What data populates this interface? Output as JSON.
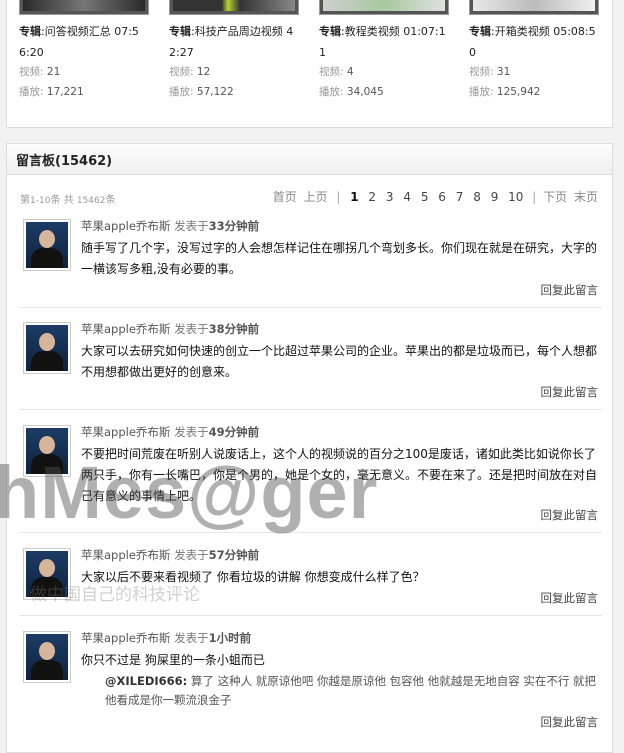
{
  "albums": [
    {
      "prefix": "专辑",
      "title": ":问答视频汇总 07:56:20",
      "videos_label": "视频",
      "videos": "21",
      "plays_label": "播放",
      "plays": "17,221"
    },
    {
      "prefix": "专辑",
      "title": ":科技产品周边视频 42:27",
      "videos_label": "视频",
      "videos": "12",
      "plays_label": "播放",
      "plays": "57,122"
    },
    {
      "prefix": "专辑",
      "title": ":教程类视频 01:07:11",
      "videos_label": "视频",
      "videos": "4",
      "plays_label": "播放",
      "plays": "34,045"
    },
    {
      "prefix": "专辑",
      "title": ":开箱类视频 05:08:50",
      "videos_label": "视频",
      "videos": "31",
      "plays_label": "播放",
      "plays": "125,942"
    }
  ],
  "board": {
    "title": "留言板(15462)",
    "info_prefix": "第",
    "info_range": "1-10",
    "info_mid": "条 共",
    "info_total": "15462",
    "info_suffix": "条",
    "pager": {
      "first": "首页",
      "prev": "上页",
      "pages": [
        "1",
        "2",
        "3",
        "4",
        "5",
        "6",
        "7",
        "8",
        "9",
        "10"
      ],
      "current": "1",
      "next": "下页",
      "last": "末页"
    },
    "reply_label": "回复此留言",
    "messages": [
      {
        "user": "苹果apple乔布斯",
        "posted_prefix": "发表于",
        "time": "33分钟前",
        "text": "随手写了几个字，没写过字的人会想怎样记住在哪拐几个弯划多长。你们现在就是在研究，大字的一横该写多粗,没有必要的事。"
      },
      {
        "user": "苹果apple乔布斯",
        "posted_prefix": "发表于",
        "time": "38分钟前",
        "text": "大家可以去研究如何快速的创立一个比超过苹果公司的企业。苹果出的都是垃圾而已，每个人想都不用想都做出更好的创意来。"
      },
      {
        "user": "苹果apple乔布斯",
        "posted_prefix": "发表于",
        "time": "49分钟前",
        "text": "不要把时间荒废在听别人说废话上，这个人的视频说的百分之100是废话，诸如此类比如说你长了两只手，你有一长嘴巴，你是个男的，她是个女的，毫无意义。不要在来了。还是把时间放在对自己有意义的事情上吧。"
      },
      {
        "user": "苹果apple乔布斯",
        "posted_prefix": "发表于",
        "time": "57分钟前",
        "text": "大家以后不要来看视频了 你看垃圾的讲解 你想变成什么样了色？"
      },
      {
        "user": "苹果apple乔布斯",
        "posted_prefix": "发表于",
        "time": "1小时前",
        "text": "你只不过是 狗屎里的一条小蛆而已",
        "subreply_user": "@XILEDI666:",
        "subreply_text": " 算了 这种人 就原谅他吧 你越是原谅他 包容他 他就越是无地自容 实在不行 就把他看成是你一颗流浪金子"
      }
    ]
  },
  "watermark": {
    "big": "hMes@ger",
    "small": "做中国自己的科技评论"
  }
}
